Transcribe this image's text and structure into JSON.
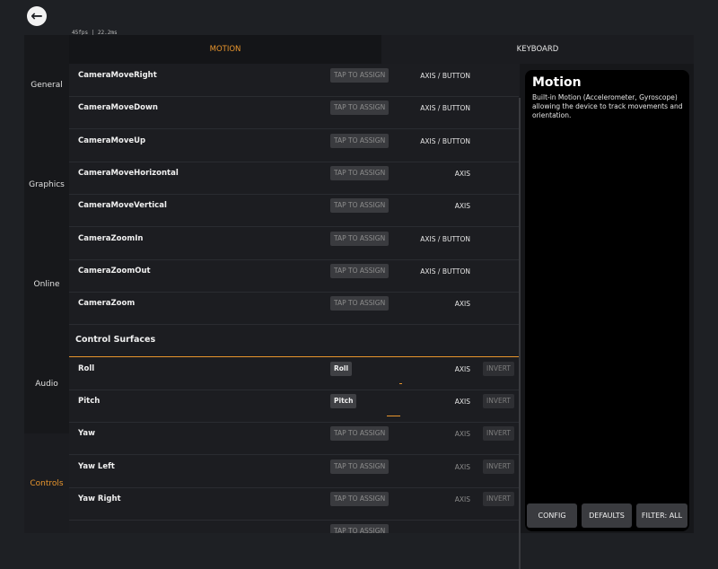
{
  "fps_text": "45fps | 22.2ms",
  "sidebar": {
    "items": [
      "General",
      "Graphics",
      "Online",
      "Audio",
      "Controls"
    ],
    "active": "Controls"
  },
  "tabs": [
    "MOTION",
    "KEYBOARD"
  ],
  "rows": [
    {
      "name": "CameraMoveRight",
      "assign": "TAP TO ASSIGN",
      "type": "AXIS / BUTTON"
    },
    {
      "name": "CameraMoveDown",
      "assign": "TAP TO ASSIGN",
      "type": "AXIS / BUTTON"
    },
    {
      "name": "CameraMoveUp",
      "assign": "TAP TO ASSIGN",
      "type": "AXIS / BUTTON"
    },
    {
      "name": "CameraMoveHorizontal",
      "assign": "TAP TO ASSIGN",
      "type": "AXIS"
    },
    {
      "name": "CameraMoveVertical",
      "assign": "TAP TO ASSIGN",
      "type": "AXIS"
    },
    {
      "name": "CameraZoomIn",
      "assign": "TAP TO ASSIGN",
      "type": "AXIS / BUTTON"
    },
    {
      "name": "CameraZoomOut",
      "assign": "TAP TO ASSIGN",
      "type": "AXIS / BUTTON"
    },
    {
      "name": "CameraZoom",
      "assign": "TAP TO ASSIGN",
      "type": "AXIS"
    }
  ],
  "section_title": "Control Surfaces",
  "surface_rows": [
    {
      "name": "Roll",
      "assign": "Roll",
      "bound": true,
      "type": "AXIS",
      "invert": "INVERT"
    },
    {
      "name": "Pitch",
      "assign": "Pitch",
      "bound": true,
      "type": "AXIS",
      "invert": "INVERT"
    },
    {
      "name": "Yaw",
      "assign": "TAP TO ASSIGN",
      "bound": false,
      "type": "AXIS",
      "invert": "INVERT"
    },
    {
      "name": "Yaw Left",
      "assign": "TAP TO ASSIGN",
      "bound": false,
      "type": "AXIS",
      "invert": "INVERT"
    },
    {
      "name": "Yaw Right",
      "assign": "TAP TO ASSIGN",
      "bound": false,
      "type": "AXIS",
      "invert": "INVERT"
    },
    {
      "name": "",
      "assign": "TAP TO ASSIGN",
      "bound": false,
      "type": "",
      "invert": ""
    }
  ],
  "info": {
    "title": "Motion",
    "description": "Built-in Motion (Accelerometer, Gyroscope) allowing the device to track movements and orientation.",
    "buttons": [
      "CONFIG",
      "DEFAULTS",
      "FILTER: ALL"
    ]
  },
  "colors": {
    "accent": "#e8952d",
    "background": "#1e2024"
  },
  "icons": {
    "back": "arrow-left-icon"
  }
}
